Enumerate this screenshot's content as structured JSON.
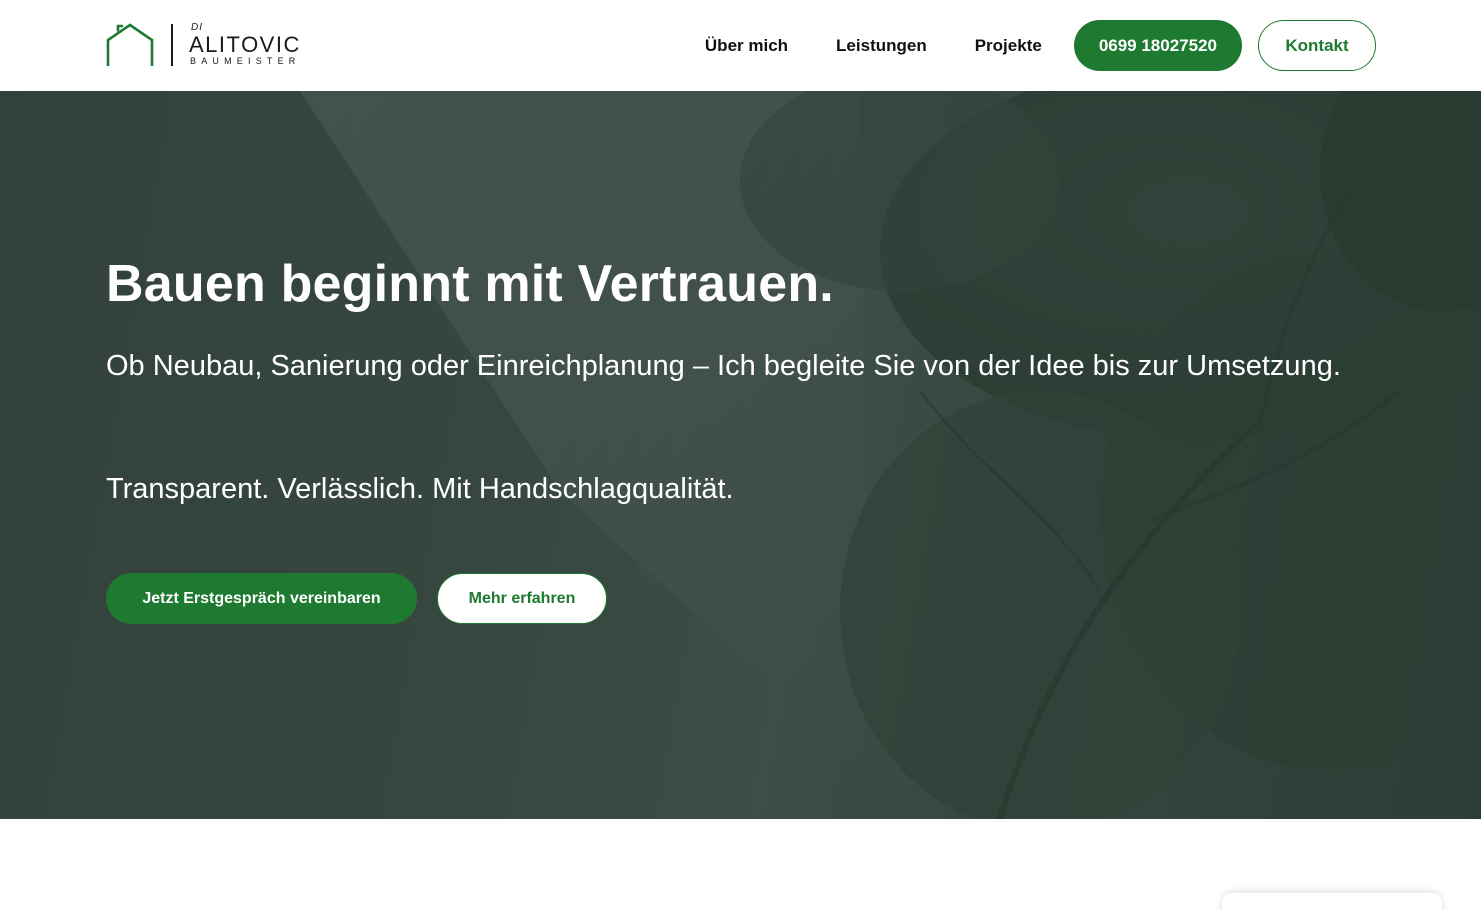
{
  "brand": {
    "prefix": "DI",
    "name": "ALITOVIC",
    "subtitle": "BAUMEISTER",
    "accent_color": "#1e7a30"
  },
  "nav": {
    "items": [
      "Über mich",
      "Leistungen",
      "Projekte"
    ],
    "phone": "0699 18027520",
    "contact": "Kontakt"
  },
  "hero": {
    "title": "Bauen beginnt mit Vertrauen.",
    "subtitle": "Ob Neubau, Sanierung oder Einreichplanung – Ich begleite Sie von der Idee bis zur Umsetzung.",
    "tagline": "Transparent. Verlässlich. Mit Handschlagqualität.",
    "primary_cta": "Jetzt Erstgespräch vereinbaren",
    "secondary_cta": "Mehr erfahren"
  },
  "icons": {
    "logo": "house-outline-icon"
  }
}
